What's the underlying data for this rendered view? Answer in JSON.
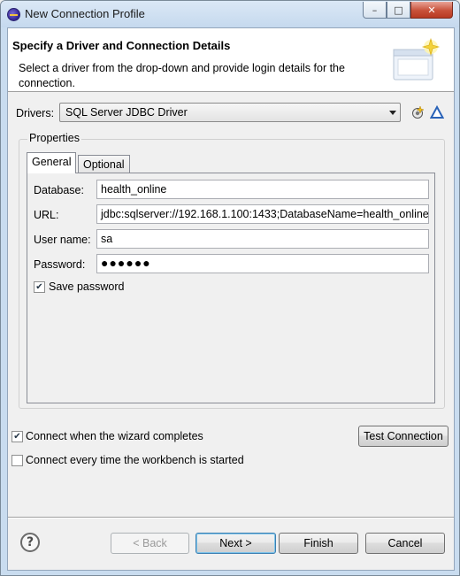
{
  "window": {
    "title": "New Connection Profile",
    "minimize_glyph": "–",
    "maximize_glyph": "□",
    "close_glyph": "✕"
  },
  "header": {
    "title": "Specify a Driver and Connection Details",
    "description": "Select a driver from the drop-down and provide login details for the connection."
  },
  "drivers": {
    "label": "Drivers:",
    "selected": "SQL Server JDBC Driver"
  },
  "properties": {
    "legend": "Properties",
    "tabs": [
      "General",
      "Optional"
    ],
    "fields": {
      "database_label": "Database:",
      "database_value": "health_online",
      "url_label": "URL:",
      "url_value": "jdbc:sqlserver://192.168.1.100:1433;DatabaseName=health_online",
      "username_label": "User name:",
      "username_value": "sa",
      "password_label": "Password:",
      "password_value": "●●●●●●"
    },
    "save_password": {
      "label": "Save password",
      "checked": true
    }
  },
  "options": {
    "connect_on_complete": {
      "label": "Connect when the wizard completes",
      "checked": true
    },
    "connect_on_startup": {
      "label": "Connect every time the workbench is started",
      "checked": false
    },
    "test_connection": "Test Connection"
  },
  "footer": {
    "back": "< Back",
    "next": "Next >",
    "finish": "Finish",
    "cancel": "Cancel",
    "help_glyph": "?"
  },
  "colors": {
    "titlebar": "#c9dcef",
    "accent": "#3c7fb1",
    "close_button": "#c8513a"
  },
  "icons": [
    "eclipse-app-icon",
    "wizard-banner-icon",
    "new-driver-icon",
    "edit-driver-icon",
    "help-icon",
    "checkmark-icon"
  ]
}
